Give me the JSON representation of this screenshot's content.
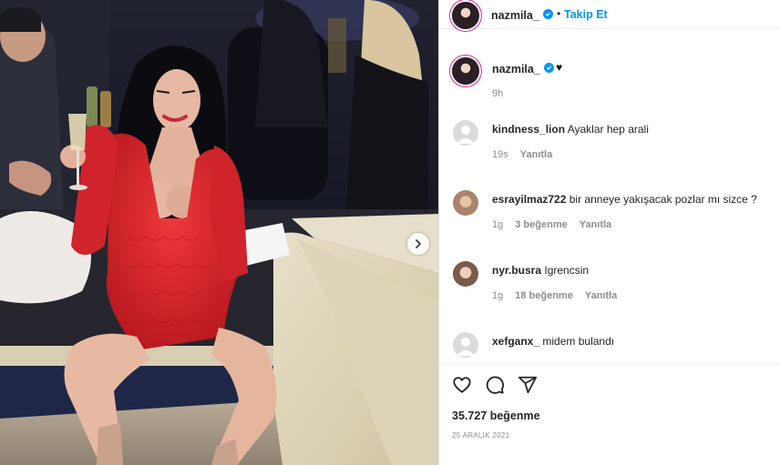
{
  "header": {
    "username": "nazmila_",
    "separator": "•",
    "follow_label": "Takip Et"
  },
  "caption": {
    "username": "nazmila_",
    "emoji": "♥",
    "time": "9h"
  },
  "comments": [
    {
      "username": "kindness_lion",
      "text": "Ayaklar hep arali",
      "time": "19s",
      "likes": "",
      "reply": "Yanıtla"
    },
    {
      "username": "esrayilmaz722",
      "text": "bir anneye yakışacak pozlar mı sizce ?",
      "time": "1g",
      "likes": "3 beğenme",
      "reply": "Yanıtla"
    },
    {
      "username": "nyr.busra",
      "text": "Igrencsin",
      "time": "1g",
      "likes": "18 beğenme",
      "reply": "Yanıtla"
    },
    {
      "username": "xefganx_",
      "text": "midem bulandı",
      "time": "",
      "likes": "",
      "reply": ""
    }
  ],
  "post": {
    "likes_count": "35.727 beğenme",
    "date": "25 ARALIK 2021"
  },
  "icons": {
    "verified": "verified-badge-icon",
    "like": "heart-icon",
    "comment": "comment-icon",
    "share": "share-icon",
    "next": "chevron-right-icon"
  },
  "colors": {
    "accent": "#0095f6",
    "dress": "#d8262e",
    "text": "#262626",
    "muted": "#8e8e8e"
  }
}
